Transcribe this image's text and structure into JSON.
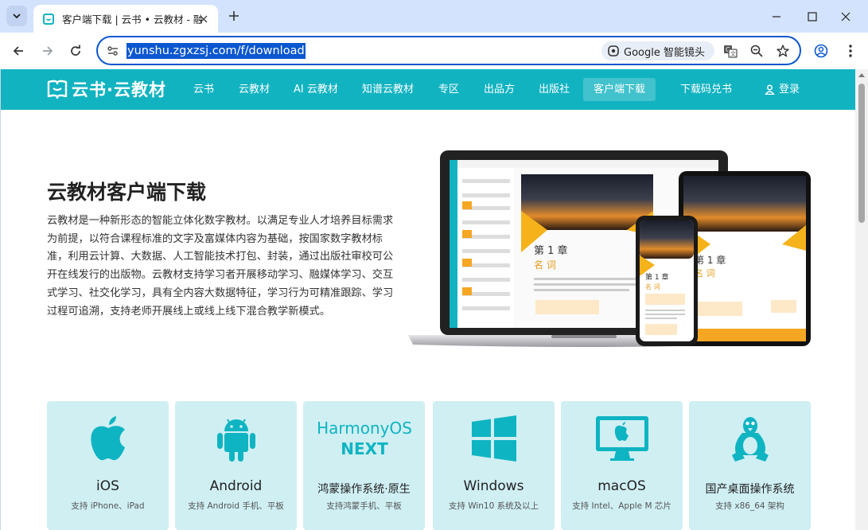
{
  "browser": {
    "tab_title": "客户端下载 | 云书 • 云教材 - 融",
    "url": "yunshu.zgxzsj.com/f/download",
    "lens_label": "Google 智能镜头"
  },
  "site": {
    "logo_text": "云书·云教材",
    "nav": [
      "云书",
      "云教材",
      "AI 云教材",
      "知谱云教材",
      "专区",
      "出品方",
      "出版社",
      "客户端下载",
      "下载码兑书"
    ],
    "login": "登录"
  },
  "hero": {
    "title": "云教材客户端下载",
    "description": "云教材是一种新形态的智能立体化数字教材。以满足专业人才培养目标需求为前提，以符合课程标准的文字及富媒体内容为基础，按国家数字教材标准，利用云计算、大数据、人工智能技术打包、封装，通过出版社审校可公开在线发行的出版物。云教材支持学习者开展移动学习、融媒体学习、交互式学习、社交化学习，具有全内容大数据特征，学习行为可精准跟踪、学习过程可追溯，支持老师开展线上或线上线下混合教学新模式。"
  },
  "mockup": {
    "chapter": "第 1 章",
    "term": "名  词"
  },
  "platforms": [
    {
      "name": "iOS",
      "desc": "支持 iPhone、iPad",
      "icon": "apple-icon"
    },
    {
      "name": "Android",
      "desc": "支持 Android 手机、平板",
      "icon": "android-icon"
    },
    {
      "name": "鸿蒙操作系统·原生",
      "desc": "支持鸿蒙手机、平板",
      "icon": "harmonyos-next-logo",
      "logo_line1": "HarmonyOS",
      "logo_line2": "NEXT"
    },
    {
      "name": "Windows",
      "desc": "支持 Win10 系统及以上",
      "icon": "windows-icon"
    },
    {
      "name": "macOS",
      "desc": "支持 Intel、Apple M 芯片",
      "icon": "imac-icon"
    },
    {
      "name": "国产桌面操作系统",
      "desc": "支持 x86_64 架构",
      "icon": "linux-penguin-icon"
    }
  ],
  "colors": {
    "brand": "#12b3c1",
    "card_bg": "#cfeff3",
    "address_highlight": "#0b57d0"
  }
}
